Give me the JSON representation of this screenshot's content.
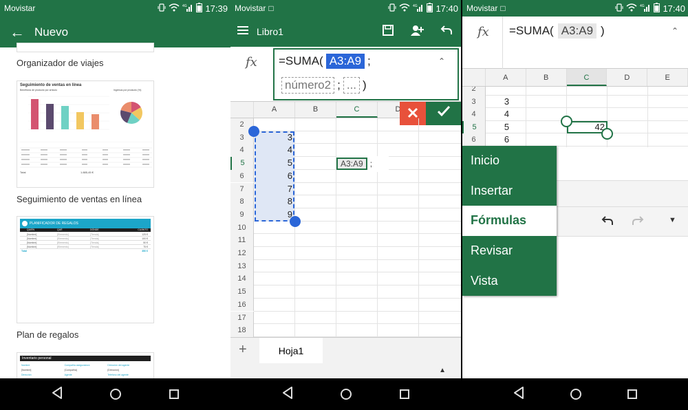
{
  "colors": {
    "accent": "#217346",
    "selection": "#2b66d8"
  },
  "status": [
    {
      "carrier": "Movistar",
      "time": "17:39",
      "net": "4G"
    },
    {
      "carrier": "Movistar",
      "time": "17:40",
      "net": "4G"
    },
    {
      "carrier": "Movistar",
      "time": "17:40",
      "net": "4G"
    }
  ],
  "panel1": {
    "title": "Nuevo",
    "templates": [
      {
        "label": "Organizador de viajes"
      },
      {
        "label": "Seguimiento de ventas en línea",
        "thumb_title": "Seguimiento de ventas en línea",
        "thumb_sub1": "Beneficios de producto por artículo",
        "thumb_sub2": "Ingresos por producto (%)",
        "total_label": "Total",
        "total_value": "1.885,45 €"
      },
      {
        "label": "Plan de regalos",
        "thumb_title": "PLANIFICADOR DE REGALOS",
        "cols": [
          "QUIÉN",
          "QUÉ",
          "DÓNDE",
          "CUÁNTO"
        ],
        "rows": [
          [
            "[Nombre]",
            "[Elemento]",
            "[Tienda]",
            "125 €"
          ],
          [
            "[Nombre]",
            "[Elemento]",
            "[Tienda]",
            "100 €"
          ],
          [
            "[Nombre]",
            "[Elemento]",
            "[Tienda]",
            "50 €"
          ],
          [
            "[Nombre]",
            "[Elemento]",
            "[Tienda]",
            "75 €"
          ]
        ],
        "total_label": "Total",
        "total_value": "350 €"
      },
      {
        "thumb_title": "Inventario personal",
        "fields": [
          "Nombre",
          "Compañía aseguradora",
          "Dirección del agente",
          "[Nombre]",
          "[Compañía]",
          "[Dirección]",
          "Dirección",
          "Agente",
          "Teléfono del agente"
        ]
      }
    ]
  },
  "panel2": {
    "title": "Libro1",
    "formula_prefix": "=SUMA(",
    "formula_range": "A3:A9",
    "formula_sep": ";",
    "formula_arg": "número2",
    "formula_more": "...",
    "formula_close": ")",
    "columns": [
      "A",
      "B",
      "C",
      "D"
    ],
    "rows": [
      "2",
      "3",
      "4",
      "5",
      "6",
      "7",
      "8",
      "9",
      "10",
      "11",
      "12",
      "13",
      "14",
      "15",
      "16",
      "17",
      "18"
    ],
    "colA": [
      "3",
      "4",
      "5",
      "6",
      "7",
      "8",
      "9"
    ],
    "cell_edit": "A3:A9",
    "cell_edit_sep": ";",
    "sheet_tab": "Hoja1",
    "add_sheet": "+"
  },
  "panel3": {
    "formula_prefix": "=SUMA(",
    "formula_range": "A3:A9",
    "formula_close": ")",
    "columns": [
      "A",
      "B",
      "C",
      "D",
      "E"
    ],
    "rows": [
      "2",
      "3",
      "4",
      "5",
      "6"
    ],
    "colA": [
      "3",
      "4",
      "5",
      "6"
    ],
    "cell_value": "42",
    "menu": [
      "Inicio",
      "Insertar",
      "Fórmulas",
      "Revisar",
      "Vista"
    ],
    "menu_selected": 2
  }
}
